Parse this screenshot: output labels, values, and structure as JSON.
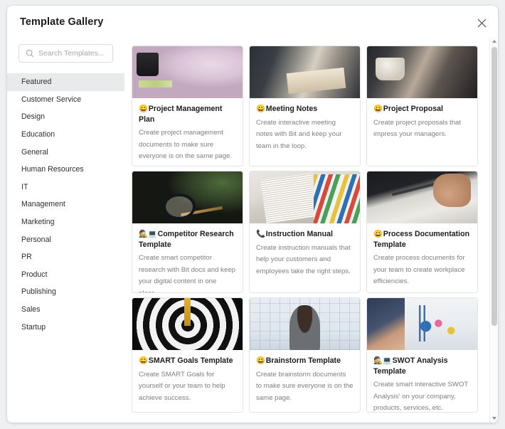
{
  "header": {
    "title": "Template Gallery",
    "close_icon": "close-icon"
  },
  "sidebar": {
    "search": {
      "icon": "search-icon",
      "placeholder": "Search Templates...",
      "value": ""
    },
    "items": [
      {
        "label": "Featured",
        "active": true
      },
      {
        "label": "Customer Service",
        "active": false
      },
      {
        "label": "Design",
        "active": false
      },
      {
        "label": "Education",
        "active": false
      },
      {
        "label": "General",
        "active": false
      },
      {
        "label": "Human Resources",
        "active": false
      },
      {
        "label": "IT",
        "active": false
      },
      {
        "label": "Management",
        "active": false
      },
      {
        "label": "Marketing",
        "active": false
      },
      {
        "label": "Personal",
        "active": false
      },
      {
        "label": "PR",
        "active": false
      },
      {
        "label": "Product",
        "active": false
      },
      {
        "label": "Publishing",
        "active": false
      },
      {
        "label": "Sales",
        "active": false
      },
      {
        "label": "Startup",
        "active": false
      }
    ]
  },
  "gallery": {
    "cards": [
      {
        "emoji": "😀",
        "emoji_name": "grinning-face-icon",
        "title": "Project Management Plan",
        "description": "Create project management documents to make sure everyone is on the same page.",
        "thumb_name": "project-management-thumbnail"
      },
      {
        "emoji": "😀",
        "emoji_name": "grinning-face-icon",
        "title": "Meeting Notes",
        "description": "Create interactive meeting notes with Bit and keep your team in the loop.",
        "thumb_name": "meeting-notes-thumbnail"
      },
      {
        "emoji": "😀",
        "emoji_name": "grinning-face-icon",
        "title": "Project Proposal",
        "description": "Create project proposals that impress your managers.",
        "thumb_name": "project-proposal-thumbnail"
      },
      {
        "emoji": "🕵️💻",
        "emoji_name": "detective-computer-icon",
        "title": "Competitor Research Template",
        "description": "Create smart competitor research with Bit docs and keep your digital content in one place.",
        "thumb_name": "competitor-research-thumbnail"
      },
      {
        "emoji": "📞",
        "emoji_name": "telephone-receiver-icon",
        "title": "Instruction Manual",
        "description": "Create instruction manuals that help your customers and employees take the right steps.",
        "thumb_name": "instruction-manual-thumbnail"
      },
      {
        "emoji": "😀",
        "emoji_name": "grinning-face-icon",
        "title": "Process Documentation Template",
        "description": "Create process documents for your team to create workplace efficiencies.",
        "thumb_name": "process-documentation-thumbnail"
      },
      {
        "emoji": "😀",
        "emoji_name": "grinning-face-icon",
        "title": "SMART Goals Template",
        "description": "Create SMART Goals for yourself or your team to help achieve success.",
        "thumb_name": "smart-goals-thumbnail"
      },
      {
        "emoji": "😀",
        "emoji_name": "grinning-face-icon",
        "title": "Brainstorm Template",
        "description": "Create brainstorm documents to make sure everyone is on the same page.",
        "thumb_name": "brainstorm-thumbnail"
      },
      {
        "emoji": "🕵️💻",
        "emoji_name": "detective-computer-icon",
        "title": "SWOT Analysis Template",
        "description": "Create smart interactive SWOT Analysis' on your company, products, services, etc.",
        "thumb_name": "swot-analysis-thumbnail"
      }
    ]
  },
  "scrollbar": {
    "up_icon": "chevron-up-icon",
    "down_icon": "chevron-down-icon"
  },
  "colors": {
    "active_item_bg": "#e9eaeb",
    "title_text": "#1c1c1c",
    "body_text": "#7d7f83",
    "card_border": "#e3e4e6",
    "page_bg": "#eef0f2"
  }
}
